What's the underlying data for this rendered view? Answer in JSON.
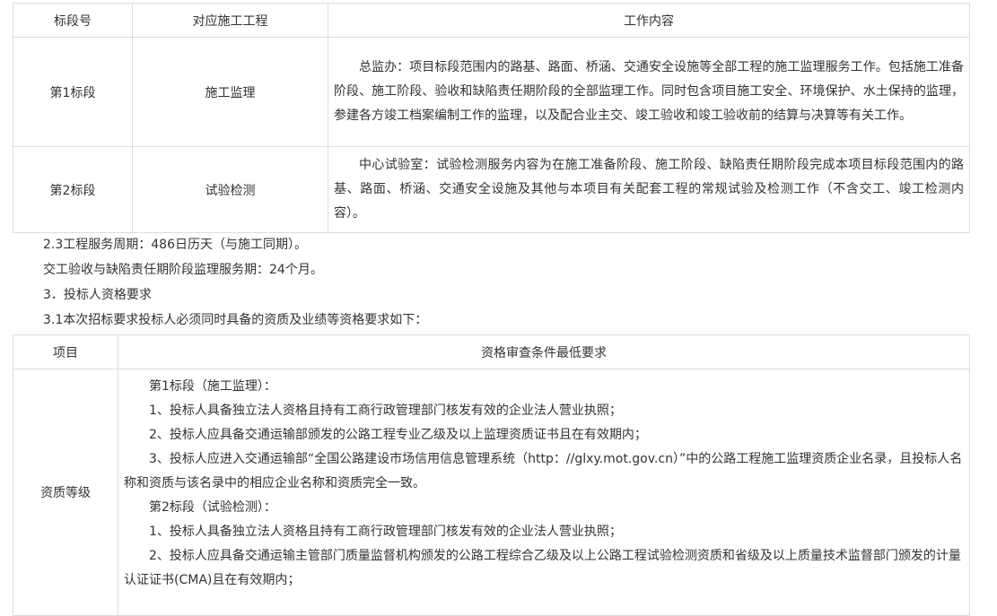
{
  "table1": {
    "headers": [
      "标段号",
      "对应施工工程",
      "工作内容"
    ],
    "rows": [
      {
        "section": "第1标段",
        "engineering": "施工监理",
        "content": "总监办：项目标段范围内的路基、路面、桥涵、交通安全设施等全部工程的施工监理服务工作。包括施工准备阶段、施工阶段、验收和缺陷责任期阶段的全部监理工作。同时包含项目施工安全、环境保护、水土保持的监理，参建各方竣工档案编制工作的监理，以及配合业主交、竣工验收和竣工验收前的结算与决算等有关工作。"
      },
      {
        "section": "第2标段",
        "engineering": "试验检测",
        "content": "中心试验室：试验检测服务内容为在施工准备阶段、施工阶段、缺陷责任期阶段完成本项目标段范围内的路基、路面、桥涵、交通安全设施及其他与本项目有关配套工程的常规试验及检测工作（不含交工、竣工检测内容）。"
      }
    ]
  },
  "lines": [
    "2.3工程服务周期：486日历天（与施工同期）。",
    "交工验收与缺陷责任期阶段监理服务期：24个月。",
    "3．投标人资格要求",
    "3.1本次招标要求投标人必须同时具备的资质及业绩等资格要求如下："
  ],
  "table2": {
    "headers": [
      "项目",
      "资格审查条件最低要求"
    ],
    "row_label": "资质等级",
    "items": [
      "第1标段（施工监理）：",
      "1、投标人具备独立法人资格且持有工商行政管理部门核发有效的企业法人营业执照；",
      "2、投标人应具备交通运输部颁发的公路工程专业乙级及以上监理资质证书且在有效期内；",
      "3、投标人应进入交通运输部“全国公路建设市场信用信息管理系统（http：//glxy.mot.gov.cn）”中的公路工程施工监理资质企业名录，且投标人名称和资质与该名录中的相应企业名称和资质完全一致。",
      "第2标段（试验检测）：",
      "1、投标人具备独立法人资格且持有工商行政管理部门核发有效的企业法人营业执照；",
      "2、投标人应具备交通运输主管部门质量监督机构颁发的公路工程综合乙级及以上公路工程试验检测资质和省级及以上质量技术监督部门颁发的计量认证证书(CMA)且在有效期内；"
    ]
  }
}
